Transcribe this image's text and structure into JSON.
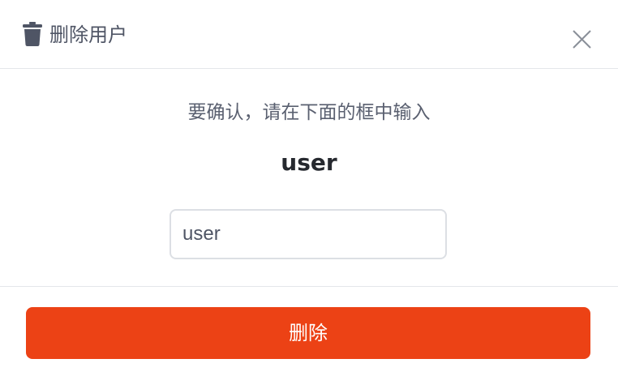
{
  "dialog": {
    "title": "删除用户",
    "title_icon": "trash-icon",
    "close_icon": "close-icon"
  },
  "body": {
    "prompt": "要确认，请在下面的框中输入",
    "confirm_name": "user",
    "input_value": "user"
  },
  "footer": {
    "delete_label": "删除"
  },
  "colors": {
    "danger": "#ec4215",
    "title_text": "#4f5565",
    "divider": "#e4e6ea"
  }
}
